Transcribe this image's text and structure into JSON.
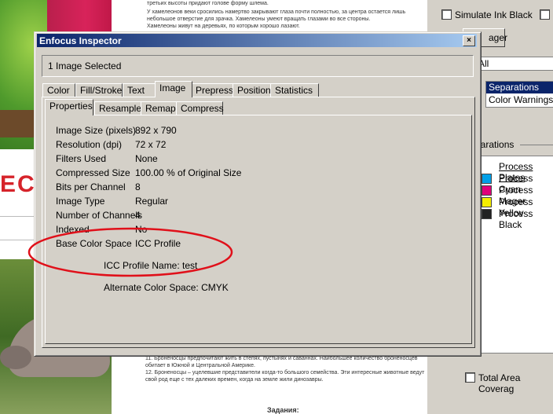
{
  "inspector": {
    "title": "Enfocus Inspector",
    "close_label": "×",
    "selection_status": "1 Image Selected",
    "main_tabs": [
      "Color",
      "Fill/Stroke",
      "Text",
      "Image",
      "Prepress",
      "Position",
      "Statistics"
    ],
    "active_main_tab": "Image",
    "sub_tabs": [
      "Properties",
      "Resample",
      "Remap",
      "Compress"
    ],
    "active_sub_tab": "Properties",
    "properties": [
      {
        "label": "Image Size (pixels)",
        "value": "892 x 790"
      },
      {
        "label": "Resolution (dpi)",
        "value": "72 x 72"
      },
      {
        "label": "Filters Used",
        "value": "None"
      },
      {
        "label": "Compressed Size",
        "value": "100.00 % of Original Size"
      },
      {
        "label": "Bits per Channel",
        "value": "8"
      },
      {
        "label": "Image Type",
        "value": "Regular"
      },
      {
        "label": "Number of Channels",
        "value": "4"
      },
      {
        "label": "Indexed",
        "value": "No"
      },
      {
        "label": "Base Color Space",
        "value": "ICC Profile"
      }
    ],
    "icc_profile_name": "ICC Profile Name: test",
    "alternate_color_space": "Alternate Color Space: CMYK",
    "annotation_color": "#e0101a"
  },
  "output_preview": {
    "simulate_ink_black": "Simulate Ink Black",
    "manager_button_partial": "ager",
    "dropdown_partial": "All",
    "view_list": [
      "Separations",
      "Color Warnings"
    ],
    "selected_view": "Separations",
    "separations_heading_partial": "parations",
    "plates": [
      {
        "label": "Process Plates",
        "color": ""
      },
      {
        "label": "Process Cyan",
        "color": "#00a0e8"
      },
      {
        "label": "Process Mager",
        "color": "#e0007a"
      },
      {
        "label": "Process Yellov",
        "color": "#f5ee00"
      },
      {
        "label": "Process Black",
        "color": "#222222"
      }
    ],
    "total_area_coverage": "Total Area Coverag"
  },
  "document": {
    "top_lines": [
      "третьих высоты придают голове форму шлема.",
      "У хамелеонов веки сросились намертво закрывают глаза почти полностью, за центра остается лишь",
      "небольшое отверстие для зрачка. Хамелеоны умеют вращать глазами во все стороны.",
      "Хамелеоны живут на деревьях, по которым хорошо лазают."
    ],
    "bottom_lines": [
      "11. Броненосцы предпочитают жить в степях, пустынях и саваннах. Наибольшее количество броненосцев",
      "обитает в Южной и Центральной Америке.",
      "12. Броненосцы – уцелевшие представители когда-то большого семейства. Эти интересные животные ведут",
      "свой род еще с тех далеких времен, когда на земле жили динозавры."
    ],
    "heading_partial": "Задания:",
    "side_text": "ECO"
  }
}
